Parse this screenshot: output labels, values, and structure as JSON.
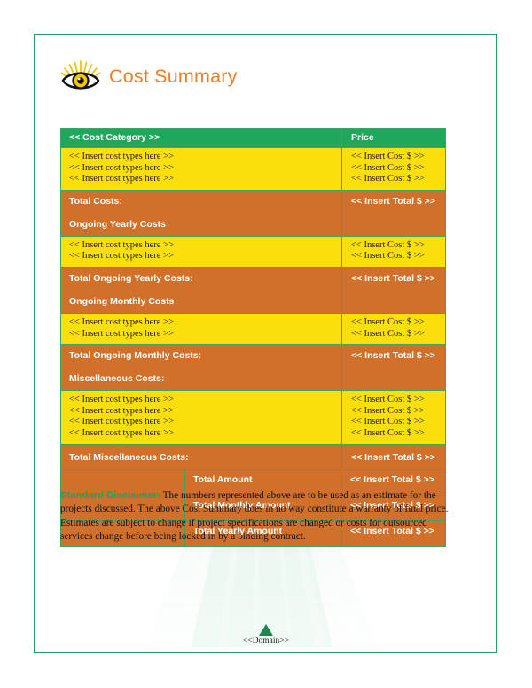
{
  "document": {
    "title": "Cost Summary",
    "logo_icon": "eye-icon",
    "accent_orange": "#F47B20",
    "accent_green": "#21A75D",
    "row_yellow": "#FBDF0C",
    "row_orange": "#D1702B",
    "border_green": "#3aa664"
  },
  "table": {
    "headers": {
      "category": "<< Cost Category >>",
      "price": "Price"
    },
    "placeholders": {
      "cost_type": "<< Insert cost types here >>",
      "cost_amount": "<< Insert Cost $ >>",
      "total_amount": "<< Insert Total $ >>"
    },
    "sections": [
      {
        "kind": "items",
        "line_count": 3,
        "lines": [
          "<< Insert cost types here >>",
          "<< Insert cost types here >>",
          "<< Insert cost types here >>"
        ],
        "prices": [
          "<< Insert Cost $ >>",
          "<< Insert Cost $ >>",
          "<< Insert Cost $ >>"
        ]
      },
      {
        "kind": "total",
        "total_label": "Total Costs:",
        "total_value": "<< Insert Total $ >>",
        "next_heading": "Ongoing Yearly Costs"
      },
      {
        "kind": "items",
        "line_count": 2,
        "lines": [
          "<< Insert cost types here >>",
          "<< Insert cost types here >>"
        ],
        "prices": [
          "<< Insert Cost $ >>",
          "<< Insert Cost $ >>"
        ]
      },
      {
        "kind": "total",
        "total_label": "Total Ongoing Yearly Costs:",
        "total_value": "<< Insert Total $ >>",
        "next_heading": "Ongoing Monthly Costs"
      },
      {
        "kind": "items",
        "line_count": 2,
        "lines": [
          "<< Insert cost types here >>",
          "<< Insert cost types here >>"
        ],
        "prices": [
          "<< Insert Cost $ >>",
          "<< Insert Cost $ >>"
        ]
      },
      {
        "kind": "total",
        "total_label": "Total Ongoing Monthly Costs:",
        "total_value": "<< Insert Total $ >>",
        "next_heading": "Miscellaneous Costs:"
      },
      {
        "kind": "items",
        "line_count": 4,
        "lines": [
          "<< Insert cost types here >>",
          "<< Insert cost types here >>",
          "<< Insert cost types here >>",
          "<< Insert cost types here >>"
        ],
        "prices": [
          "<< Insert Cost $ >>",
          "<< Insert Cost $ >>",
          "<< Insert Cost $ >>",
          "<< Insert Cost $ >>"
        ]
      },
      {
        "kind": "total_single",
        "total_label": "Total Miscellaneous Costs:",
        "total_value": "<< Insert Total $ >>"
      }
    ],
    "summary_rows": [
      {
        "label": "Total Amount",
        "value": "<< Insert Total $ >>"
      },
      {
        "label": "Total Monthly Amount",
        "value": "<< Insert Total $ >>"
      },
      {
        "label": "Total Yearly Amount",
        "value": "<< Insert Total $ >>"
      }
    ]
  },
  "disclaimer": {
    "label": "Standard Disclaimer:",
    "body": " The numbers represented above are to be used as an estimate for the projects discussed. The above Cost Summary does in no way constitute a warranty of final price.  Estimates are subject to change if project specifications are changed or costs for outsourced services change before being locked in by a binding contract."
  },
  "footer": {
    "text": "<<Domain>>",
    "icon": "triangle-icon"
  }
}
